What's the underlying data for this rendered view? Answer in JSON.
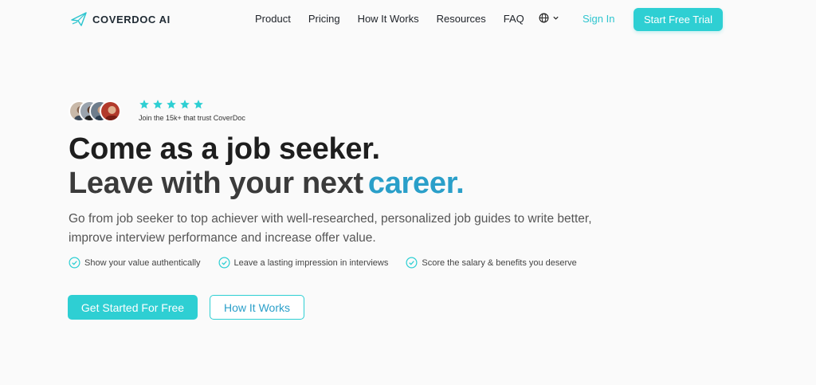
{
  "brand": {
    "name": "COVERDOC AI",
    "accent": "#2ecfd3",
    "accent_text": "#2a9fc9"
  },
  "nav": {
    "links": [
      "Product",
      "Pricing",
      "How It Works",
      "Resources",
      "FAQ"
    ],
    "language_icon": "globe-icon",
    "sign_in": "Sign In",
    "cta": "Start Free Trial"
  },
  "hero": {
    "rating_stars": 5,
    "trust_text": "Join the 15k+ that trust CoverDoc",
    "headline_line1": "Come as a job seeker.",
    "headline_line2": "Leave with your next",
    "headline_accent": "career.",
    "subtext": "Go from job seeker to top achiever with well-researched, personalized job guides to write better, improve interview performance and increase offer value.",
    "features": [
      "Show your value authentically",
      "Leave a lasting impression in interviews",
      "Score the salary & benefits you deserve"
    ],
    "primary_button": "Get Started For Free",
    "secondary_button": "How It Works"
  }
}
